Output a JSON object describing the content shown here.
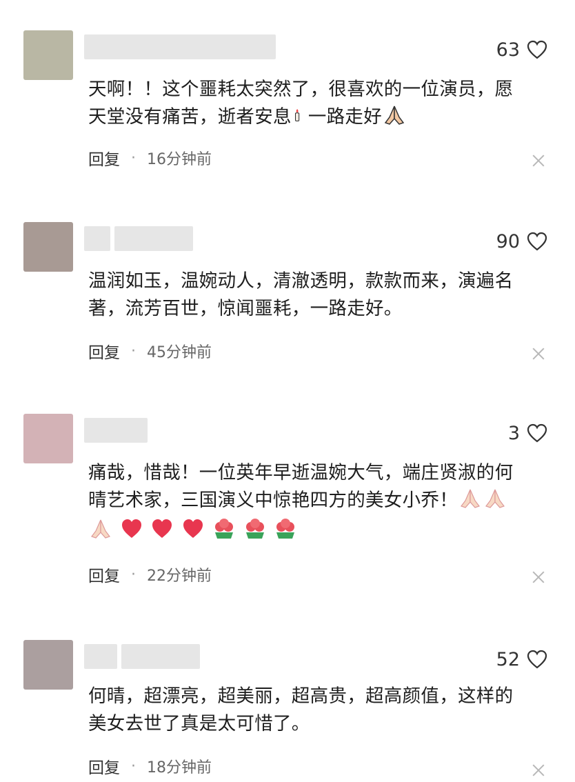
{
  "comments": [
    {
      "avatar_color": "#b9b7a4",
      "likes": "63",
      "line1": "天啊！！这个噩耗太突然了，很喜欢的一位演员，愿",
      "line2": "天堂没有痛苦，逝者安息",
      "line2_tail": "一路走好",
      "reply_label": "回复",
      "time": "16分钟前"
    },
    {
      "avatar_color": "#a89a94",
      "likes": "90",
      "line1": "温润如玉，温婉动人，清澈透明，款款而来，演遍名",
      "line2": "著，流芳百世，惊闻噩耗，一路走好。",
      "reply_label": "回复",
      "time": "45分钟前"
    },
    {
      "avatar_color": "#d3b2b6",
      "likes": "3",
      "line1": "痛哉，惜哉！一位英年早逝温婉大气，端庄贤淑的何",
      "line2": "晴艺术家，三国演义中惊艳四方的美女小乔！",
      "reply_label": "回复",
      "time": "22分钟前"
    },
    {
      "avatar_color": "#ab9f9f",
      "likes": "52",
      "line1": "何晴，超漂亮，超美丽，超高贵，超高颜值，这样的",
      "line2": "美女去世了真是太可惜了。",
      "reply_label": "回复",
      "time": "18分钟前"
    }
  ],
  "icons": {
    "like": "heart-outline-icon",
    "close": "close-icon",
    "candle": "candle-emoji",
    "pray": "folded-hands-emoji",
    "heart": "red-heart-emoji",
    "rose": "rose-bouquet-emoji"
  }
}
